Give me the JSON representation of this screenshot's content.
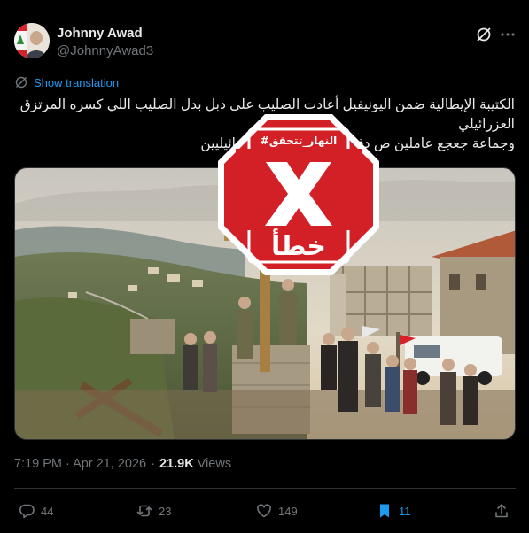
{
  "tweet": {
    "author_name": "Johnny Awad",
    "author_handle": "@JohnnyAwad3",
    "show_translation_label": "Show translation",
    "text_line_1": "الكتيبة الإيطالية ضمن اليونيفيل أعادت الصليب على دبل بدل الصليب اللي كسره المرتزق العزرائيلي",
    "text_line_2": "وجماعة جعجع عاملين ص دفاعاً عن أسيادهم العزرائيليين",
    "stamp_hashtag": "#النهار_تتحقق",
    "stamp_word": "خطأ",
    "timestamp": "7:19 PM · Apr 21, 2026",
    "views_count": "21.9K",
    "views_label": "Views"
  },
  "actions": {
    "replies": "44",
    "reposts": "23",
    "likes": "149",
    "bookmarks": "11"
  },
  "colors": {
    "background": "#000000",
    "text_primary": "#e7e9ea",
    "text_secondary": "#71767b",
    "accent": "#1d9bf0",
    "stamp_red": "#d31f26"
  },
  "icons": [
    "translate-icon",
    "grok-icon",
    "more-icon",
    "reply-icon",
    "repost-icon",
    "like-icon",
    "bookmark-icon",
    "share-icon"
  ]
}
